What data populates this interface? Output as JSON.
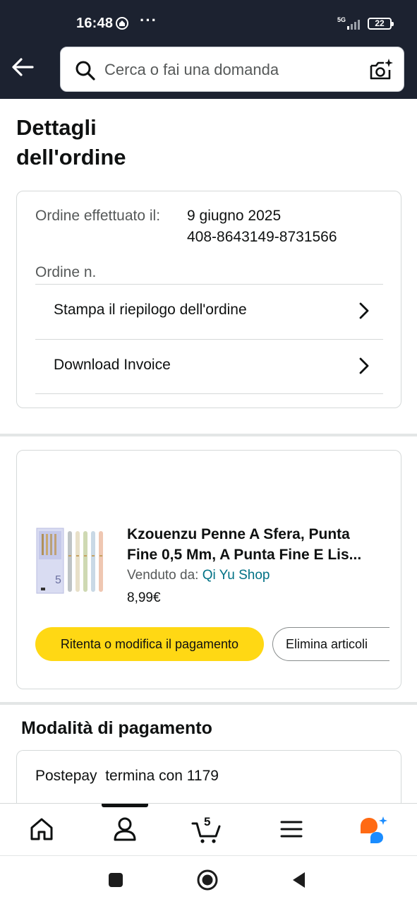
{
  "status_bar": {
    "time": "16:48",
    "more": "···",
    "network": "5G",
    "battery": "22"
  },
  "header": {
    "back_icon": "arrow-left-icon",
    "search_placeholder": "Cerca o fai una domanda",
    "search_icon": "search-icon",
    "camera_icon": "camera-sparkle-icon"
  },
  "page": {
    "title": "Dettagli dell'ordine"
  },
  "order": {
    "placed_label": "Ordine effettuato il:",
    "number_label": "Ordine n.",
    "date": "9 giugno 2025",
    "number": "408-8643149-8731566",
    "links": [
      {
        "label": "Stampa il riepilogo dell'ordine",
        "icon": "chevron-right-icon"
      },
      {
        "label": "Download Invoice",
        "icon": "chevron-right-icon"
      }
    ]
  },
  "item": {
    "title_line1": "Kzouenzu Penne A Sfera, Punta",
    "title_line2": "Fine 0,5 Mm, A Punta Fine E Lis...",
    "sold_by_label": "Venduto da:",
    "seller": "Qi Yu Shop",
    "price": "8,99€",
    "box_number": "5",
    "retry_button": "Ritenta o modifica il pagamento",
    "delete_button": "Elimina articoli"
  },
  "payment": {
    "heading": "Modalità di pagamento",
    "method": "Postepay  termina con 1179"
  },
  "bottom_nav": {
    "items": [
      {
        "name": "home",
        "icon": "home-icon"
      },
      {
        "name": "you",
        "icon": "user-icon"
      },
      {
        "name": "cart",
        "icon": "cart-icon",
        "count": "5"
      },
      {
        "name": "menu",
        "icon": "menu-icon"
      },
      {
        "name": "rufus",
        "icon": "rufus-icon"
      }
    ]
  },
  "colors": {
    "header_bg": "#1c2230",
    "accent_yellow": "#ffd814",
    "link_teal": "#007185",
    "rufus_orange": "#ff6a13",
    "rufus_blue": "#1a8cff"
  }
}
